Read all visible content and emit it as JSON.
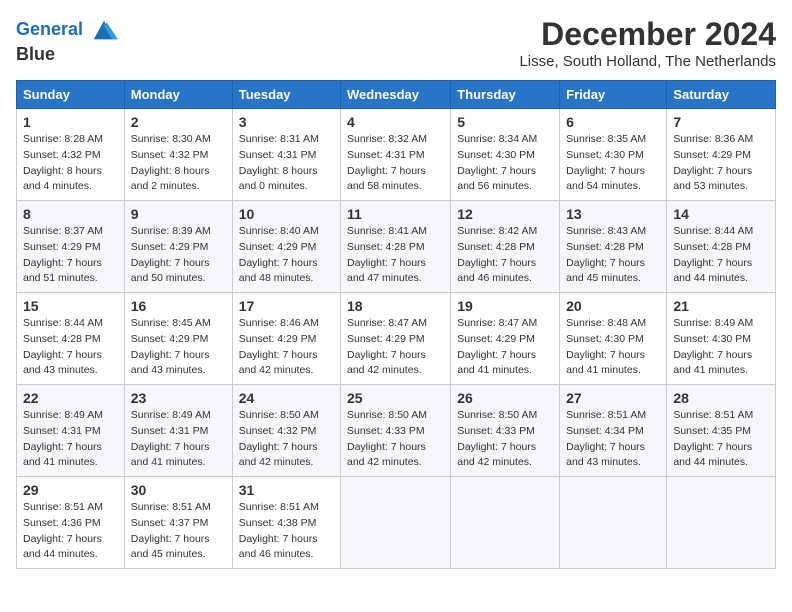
{
  "logo": {
    "line1": "General",
    "line2": "Blue"
  },
  "title": "December 2024",
  "subtitle": "Lisse, South Holland, The Netherlands",
  "headers": [
    "Sunday",
    "Monday",
    "Tuesday",
    "Wednesday",
    "Thursday",
    "Friday",
    "Saturday"
  ],
  "weeks": [
    [
      {
        "day": "1",
        "sunrise": "8:28 AM",
        "sunset": "4:32 PM",
        "daylight": "8 hours and 4 minutes."
      },
      {
        "day": "2",
        "sunrise": "8:30 AM",
        "sunset": "4:32 PM",
        "daylight": "8 hours and 2 minutes."
      },
      {
        "day": "3",
        "sunrise": "8:31 AM",
        "sunset": "4:31 PM",
        "daylight": "8 hours and 0 minutes."
      },
      {
        "day": "4",
        "sunrise": "8:32 AM",
        "sunset": "4:31 PM",
        "daylight": "7 hours and 58 minutes."
      },
      {
        "day": "5",
        "sunrise": "8:34 AM",
        "sunset": "4:30 PM",
        "daylight": "7 hours and 56 minutes."
      },
      {
        "day": "6",
        "sunrise": "8:35 AM",
        "sunset": "4:30 PM",
        "daylight": "7 hours and 54 minutes."
      },
      {
        "day": "7",
        "sunrise": "8:36 AM",
        "sunset": "4:29 PM",
        "daylight": "7 hours and 53 minutes."
      }
    ],
    [
      {
        "day": "8",
        "sunrise": "8:37 AM",
        "sunset": "4:29 PM",
        "daylight": "7 hours and 51 minutes."
      },
      {
        "day": "9",
        "sunrise": "8:39 AM",
        "sunset": "4:29 PM",
        "daylight": "7 hours and 50 minutes."
      },
      {
        "day": "10",
        "sunrise": "8:40 AM",
        "sunset": "4:29 PM",
        "daylight": "7 hours and 48 minutes."
      },
      {
        "day": "11",
        "sunrise": "8:41 AM",
        "sunset": "4:28 PM",
        "daylight": "7 hours and 47 minutes."
      },
      {
        "day": "12",
        "sunrise": "8:42 AM",
        "sunset": "4:28 PM",
        "daylight": "7 hours and 46 minutes."
      },
      {
        "day": "13",
        "sunrise": "8:43 AM",
        "sunset": "4:28 PM",
        "daylight": "7 hours and 45 minutes."
      },
      {
        "day": "14",
        "sunrise": "8:44 AM",
        "sunset": "4:28 PM",
        "daylight": "7 hours and 44 minutes."
      }
    ],
    [
      {
        "day": "15",
        "sunrise": "8:44 AM",
        "sunset": "4:28 PM",
        "daylight": "7 hours and 43 minutes."
      },
      {
        "day": "16",
        "sunrise": "8:45 AM",
        "sunset": "4:29 PM",
        "daylight": "7 hours and 43 minutes."
      },
      {
        "day": "17",
        "sunrise": "8:46 AM",
        "sunset": "4:29 PM",
        "daylight": "7 hours and 42 minutes."
      },
      {
        "day": "18",
        "sunrise": "8:47 AM",
        "sunset": "4:29 PM",
        "daylight": "7 hours and 42 minutes."
      },
      {
        "day": "19",
        "sunrise": "8:47 AM",
        "sunset": "4:29 PM",
        "daylight": "7 hours and 41 minutes."
      },
      {
        "day": "20",
        "sunrise": "8:48 AM",
        "sunset": "4:30 PM",
        "daylight": "7 hours and 41 minutes."
      },
      {
        "day": "21",
        "sunrise": "8:49 AM",
        "sunset": "4:30 PM",
        "daylight": "7 hours and 41 minutes."
      }
    ],
    [
      {
        "day": "22",
        "sunrise": "8:49 AM",
        "sunset": "4:31 PM",
        "daylight": "7 hours and 41 minutes."
      },
      {
        "day": "23",
        "sunrise": "8:49 AM",
        "sunset": "4:31 PM",
        "daylight": "7 hours and 41 minutes."
      },
      {
        "day": "24",
        "sunrise": "8:50 AM",
        "sunset": "4:32 PM",
        "daylight": "7 hours and 42 minutes."
      },
      {
        "day": "25",
        "sunrise": "8:50 AM",
        "sunset": "4:33 PM",
        "daylight": "7 hours and 42 minutes."
      },
      {
        "day": "26",
        "sunrise": "8:50 AM",
        "sunset": "4:33 PM",
        "daylight": "7 hours and 42 minutes."
      },
      {
        "day": "27",
        "sunrise": "8:51 AM",
        "sunset": "4:34 PM",
        "daylight": "7 hours and 43 minutes."
      },
      {
        "day": "28",
        "sunrise": "8:51 AM",
        "sunset": "4:35 PM",
        "daylight": "7 hours and 44 minutes."
      }
    ],
    [
      {
        "day": "29",
        "sunrise": "8:51 AM",
        "sunset": "4:36 PM",
        "daylight": "7 hours and 44 minutes."
      },
      {
        "day": "30",
        "sunrise": "8:51 AM",
        "sunset": "4:37 PM",
        "daylight": "7 hours and 45 minutes."
      },
      {
        "day": "31",
        "sunrise": "8:51 AM",
        "sunset": "4:38 PM",
        "daylight": "7 hours and 46 minutes."
      },
      null,
      null,
      null,
      null
    ]
  ]
}
